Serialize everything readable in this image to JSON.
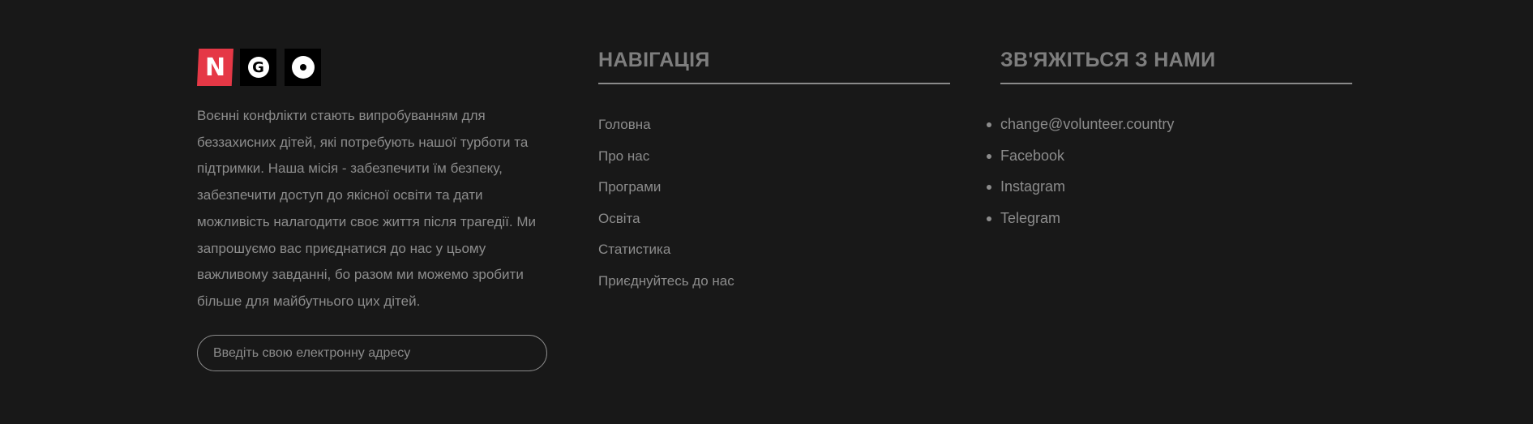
{
  "logo": {
    "letters": [
      "N",
      "G",
      "O"
    ],
    "colors": {
      "first_tile": "#e53846",
      "other_tiles": "#000000"
    }
  },
  "about": {
    "text": "Воєнні конфлікти стають випробуванням для беззахисних дітей, які потребують нашої турботи та підтримки. Наша місія - забезпечити їм безпеку, забезпечити доступ до якісної освіти та дати можливість налагодити своє життя після трагедії. Ми запрошуємо вас приєднатися до нас у цьому важливому завданні, бо разом ми можемо зробити більше для майбутнього цих дітей."
  },
  "subscribe": {
    "placeholder": "Введіть свою електронну адресу",
    "value": ""
  },
  "navigation": {
    "title": "НАВІГАЦІЯ",
    "items": [
      {
        "label": "Головна"
      },
      {
        "label": "Про нас"
      },
      {
        "label": "Програми"
      },
      {
        "label": "Освіта"
      },
      {
        "label": "Статистика"
      },
      {
        "label": "Приєднуйтесь до нас"
      }
    ]
  },
  "contact": {
    "title": "ЗВ'ЯЖІТЬСЯ З НАМИ",
    "items": [
      {
        "label": "change@volunteer.country"
      },
      {
        "label": "Facebook"
      },
      {
        "label": "Instagram"
      },
      {
        "label": "Telegram"
      }
    ]
  },
  "theme": {
    "background": "#181818",
    "text": "#8c8c8c",
    "heading": "#7e7e7e",
    "rule": "#8a8a8a"
  }
}
